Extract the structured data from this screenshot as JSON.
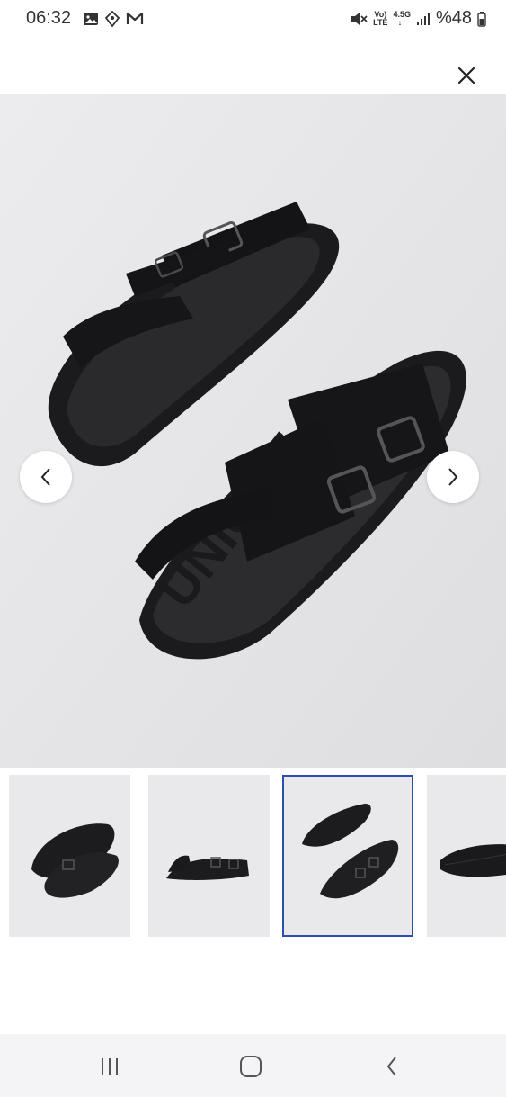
{
  "status_bar": {
    "time": "06:32",
    "left_icons": [
      "image-icon",
      "location-tag-icon",
      "gmail-icon"
    ],
    "network_top": "Vo)",
    "network_bottom": "LTE",
    "data_top": "4.5G",
    "data_bottom": "↓↑",
    "battery_text": "%48",
    "right_icons": [
      "mute-icon",
      "signal-icon",
      "battery-icon"
    ]
  },
  "viewer": {
    "close_icon": "close-icon",
    "prev_icon": "chevron-left-icon",
    "next_icon": "chevron-right-icon",
    "sole_text": "UNIQUE",
    "colors": {
      "background": "#e6e6e8",
      "sandal": "#1b1b1d",
      "active_border": "#2b4eaa"
    }
  },
  "thumbnails": {
    "items": [
      {
        "name": "thumb-1",
        "active": false
      },
      {
        "name": "thumb-2",
        "active": false
      },
      {
        "name": "thumb-3",
        "active": true
      },
      {
        "name": "thumb-4",
        "active": false
      }
    ]
  },
  "navigation_bar": {
    "recent_icon": "recent-apps-icon",
    "home_icon": "home-icon",
    "back_icon": "back-icon"
  }
}
